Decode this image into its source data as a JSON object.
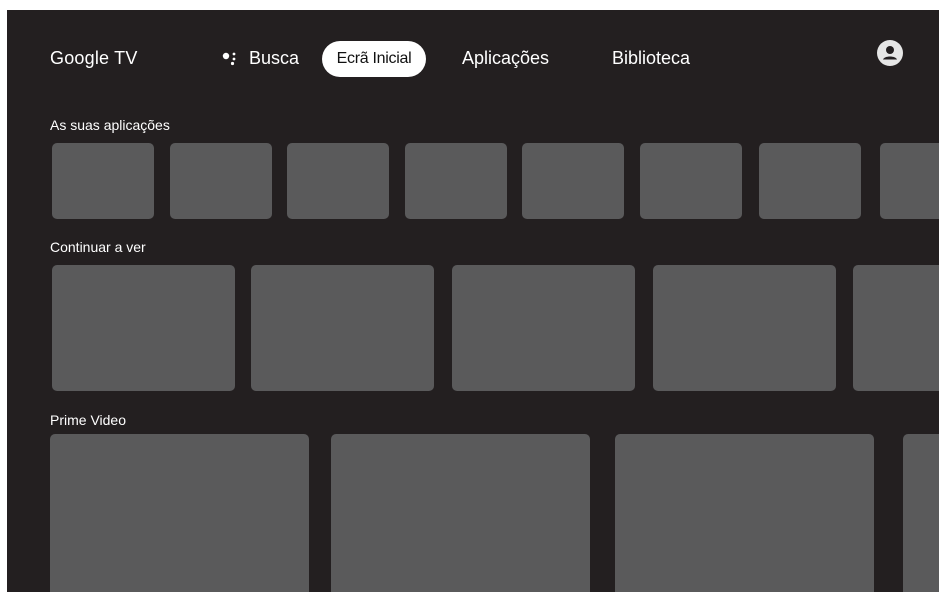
{
  "app": {
    "brand": "Google TV"
  },
  "nav": {
    "search_label": "Busca",
    "tabs": [
      {
        "label": "Ecrã Inicial",
        "selected": true
      },
      {
        "label": "Aplicações",
        "selected": false
      },
      {
        "label": "Biblioteca",
        "selected": false
      }
    ]
  },
  "icons": {
    "search": "google-assistant-icon",
    "account": "account-avatar-icon"
  },
  "rows": [
    {
      "title": "As suas aplicações",
      "tile_count": 8
    },
    {
      "title": "Continuar a ver",
      "tile_count": 5
    },
    {
      "title": "Prime Video",
      "tile_count": 4
    }
  ],
  "colors": {
    "background": "#231f20",
    "tile": "#5a5a5b",
    "selected_tab_bg": "#ffffff",
    "text": "#ffffff"
  }
}
